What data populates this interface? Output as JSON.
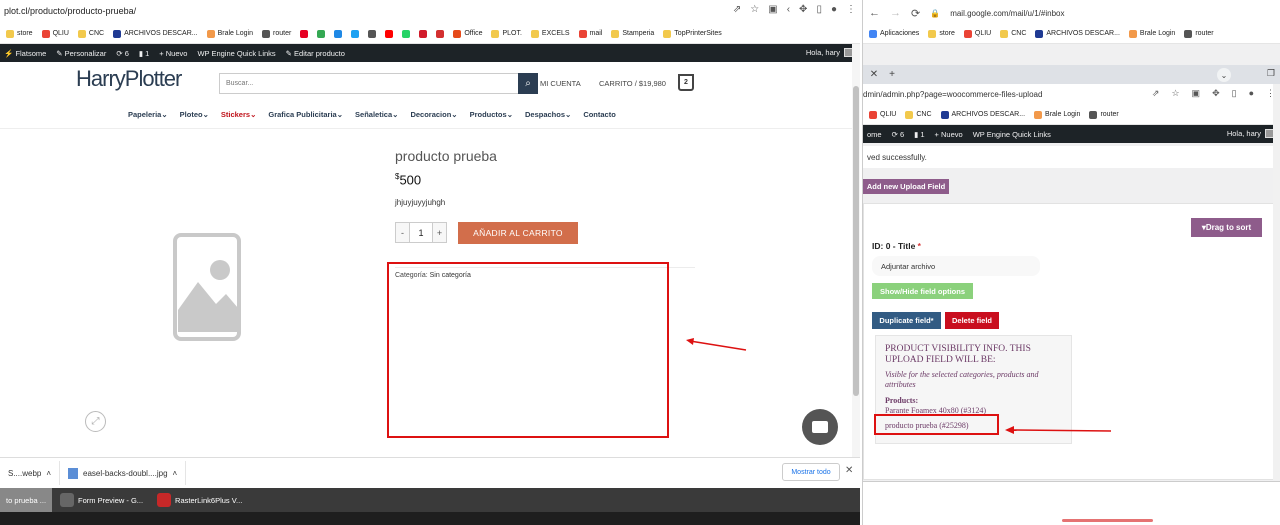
{
  "left": {
    "url": "plot.cl/producto/producto-prueba/",
    "bookmarks": [
      {
        "label": "store",
        "icon": "folder-icon",
        "color": "#f2c94c"
      },
      {
        "label": "QLIU",
        "icon": "gmail-icon",
        "color": "#ea4335"
      },
      {
        "label": "CNC",
        "icon": "folder-icon",
        "color": "#f2c94c"
      },
      {
        "label": "ARCHIVOS DESCAR...",
        "icon": "hp-icon",
        "color": "#1f3a93"
      },
      {
        "label": "Brale Login",
        "icon": "brale-icon",
        "color": "#f2994a"
      },
      {
        "label": "router",
        "icon": "globe-icon",
        "color": "#555555"
      },
      {
        "label": "",
        "icon": "pinterest-icon",
        "color": "#e60023"
      },
      {
        "label": "",
        "icon": "drive-icon",
        "color": "#34a853"
      },
      {
        "label": "",
        "icon": "paypal-icon",
        "color": "#1e88e5"
      },
      {
        "label": "",
        "icon": "twitter-icon",
        "color": "#1da1f2"
      },
      {
        "label": "",
        "icon": "globe-icon",
        "color": "#555555"
      },
      {
        "label": "",
        "icon": "youtube-icon",
        "color": "#ff0000"
      },
      {
        "label": "",
        "icon": "whatsapp-icon",
        "color": "#25d366"
      },
      {
        "label": "",
        "icon": "red-icon",
        "color": "#d11a2a"
      },
      {
        "label": "",
        "icon": "pdf-icon",
        "color": "#d32f2f"
      },
      {
        "label": "Office",
        "icon": "office-icon",
        "color": "#e64a19"
      },
      {
        "label": "PLOT.",
        "icon": "folder-icon",
        "color": "#f2c94c"
      },
      {
        "label": "EXCELS",
        "icon": "folder-icon",
        "color": "#f2c94c"
      },
      {
        "label": "mail",
        "icon": "gmail-icon",
        "color": "#ea4335"
      },
      {
        "label": "Stamperia",
        "icon": "folder-icon",
        "color": "#f2c94c"
      },
      {
        "label": "TopPrinterSites",
        "icon": "folder-icon",
        "color": "#f2c94c"
      }
    ],
    "wpbar": {
      "items": [
        "Flatsome",
        "Personalizar",
        "6",
        "1",
        "+ Nuevo",
        "WP Engine Quick Links",
        "Editar producto"
      ],
      "greeting": "Hola, hary"
    },
    "site": {
      "logo_a": "Harry",
      "logo_b": "Plotter",
      "search_placeholder": "Buscar...",
      "account": "MI CUENTA",
      "cart": "CARRITO / $19,980",
      "cart_count": "2",
      "nav": [
        "Papeleria",
        "Ploteo",
        "Stickers",
        "Grafica Publicitaria",
        "Señaletica",
        "Decoracion",
        "Productos",
        "Despachos",
        "Contacto"
      ]
    },
    "product": {
      "title": "producto prueba",
      "currency": "$",
      "price": "500",
      "description": "jhjuyjuyyjuhgh",
      "qty": "1",
      "minus": "-",
      "plus": "+",
      "add_to_cart": "AÑADIR AL CARRITO",
      "category_label": "Categoría:",
      "category_value": "Sin categoría"
    },
    "downloads": [
      {
        "name": "S....webp"
      },
      {
        "name": "easel-backs-doubl....jpg"
      }
    ],
    "show_all": "Mostrar todo",
    "taskbar": [
      {
        "label": "to prueba ...",
        "active": true
      },
      {
        "label": "Form Preview - G...",
        "active": false
      },
      {
        "label": "RasterLink6Plus V...",
        "active": false
      }
    ]
  },
  "right": {
    "url_top": "mail.google.com/mail/u/1/#inbox",
    "bookmarks_top": [
      {
        "label": "Aplicaciones",
        "icon": "apps-icon",
        "color": "#4285f4"
      },
      {
        "label": "store",
        "icon": "folder-icon",
        "color": "#f2c94c"
      },
      {
        "label": "QLIU",
        "icon": "gmail-icon",
        "color": "#ea4335"
      },
      {
        "label": "CNC",
        "icon": "folder-icon",
        "color": "#f2c94c"
      },
      {
        "label": "ARCHIVOS DESCAR...",
        "icon": "hp-icon",
        "color": "#1f3a93"
      },
      {
        "label": "Brale Login",
        "icon": "brale-icon",
        "color": "#f2994a"
      },
      {
        "label": "router",
        "icon": "globe-icon",
        "color": "#555555"
      }
    ],
    "url_admin": "dmin/admin.php?page=woocommerce-files-upload",
    "bookmarks_2": [
      {
        "label": "QLIU",
        "icon": "gmail-icon",
        "color": "#ea4335"
      },
      {
        "label": "CNC",
        "icon": "folder-icon",
        "color": "#f2c94c"
      },
      {
        "label": "ARCHIVOS DESCAR...",
        "icon": "hp-icon",
        "color": "#1f3a93"
      },
      {
        "label": "Brale Login",
        "icon": "brale-icon",
        "color": "#f2994a"
      },
      {
        "label": "router",
        "icon": "globe-icon",
        "color": "#555555"
      }
    ],
    "wpbar": {
      "items": [
        "ome",
        "6",
        "1",
        "+ Nuevo",
        "WP Engine Quick Links"
      ],
      "greeting": "Hola, hary"
    },
    "notice": "ved successfully.",
    "add_upload_field": "Add new Upload Field",
    "drag_to_sort": "Drag to sort",
    "id_title": "ID: 0 - Title",
    "required_mark": "*",
    "title_value": "Adjuntar archivo",
    "show_hide": "Show/Hide field options",
    "duplicate": "Duplicate field*",
    "delete": "Delete field",
    "visibility": {
      "heading": "PRODUCT VISIBILITY INFO. THIS UPLOAD FIELD WILL BE:",
      "sub": "Visible for the selected categories, products and attributes",
      "products_label": "Products:",
      "products": [
        "Parante Foamex 40x80 (#3124)",
        "producto prueba (#25298)"
      ]
    }
  },
  "colors": {
    "accent_purple": "#8e5c8b",
    "add_to_cart": "#d26e4b",
    "annotation_red": "#dd1111",
    "wp_admin_bar": "#1d2327"
  }
}
